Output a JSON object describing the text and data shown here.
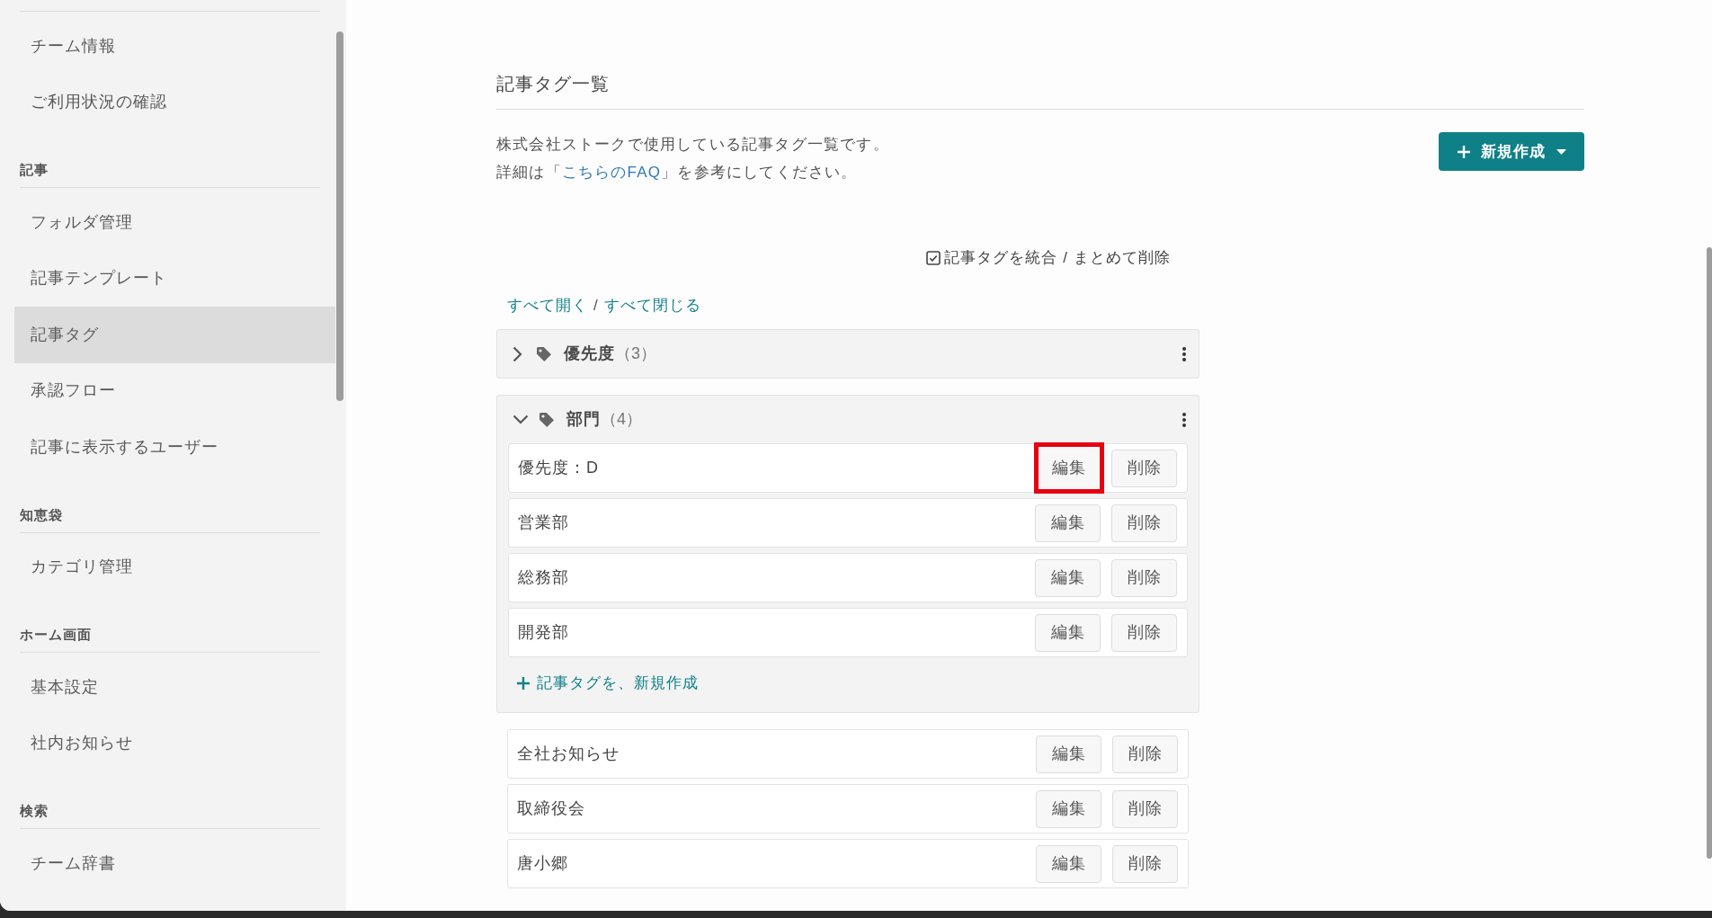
{
  "sidebar": {
    "sections": [
      {
        "items": [
          {
            "label": "チーム情報",
            "selected": false
          },
          {
            "label": "ご利用状況の確認",
            "selected": false
          }
        ]
      },
      {
        "heading": "記事",
        "items": [
          {
            "label": "フォルダ管理",
            "selected": false
          },
          {
            "label": "記事テンプレート",
            "selected": false
          },
          {
            "label": "記事タグ",
            "selected": true
          },
          {
            "label": "承認フロー",
            "selected": false
          },
          {
            "label": "記事に表示するユーザー",
            "selected": false
          }
        ]
      },
      {
        "heading": "知恵袋",
        "items": [
          {
            "label": "カテゴリ管理",
            "selected": false
          }
        ]
      },
      {
        "heading": "ホーム画面",
        "items": [
          {
            "label": "基本設定",
            "selected": false
          },
          {
            "label": "社内お知らせ",
            "selected": false
          }
        ]
      },
      {
        "heading": "検索",
        "items": [
          {
            "label": "チーム辞書",
            "selected": false
          }
        ]
      }
    ]
  },
  "main": {
    "title": "記事タグ一覧",
    "description": [
      {
        "text": "株式会社ストークで使用している記事タグ一覧です。"
      },
      {
        "text": "詳細は「",
        "link": "こちらのFAQ",
        "text_after": "」を参考にしてください。"
      }
    ],
    "new_button": {
      "label": "新規作成"
    },
    "merge_toggle": {
      "label": "記事タグを統合 / まとめて削除"
    },
    "expand_all": "すべて開く",
    "link_separator": "/",
    "collapse_all": "すべて閉じる",
    "groups": [
      {
        "name": "優先度",
        "count": "（3）",
        "expanded": false
      },
      {
        "name": "部門",
        "count": "（4）",
        "expanded": true,
        "tags": [
          {
            "name": "優先度：D",
            "actions": [
              {
                "label": "編集",
                "highlighted": true
              },
              {
                "label": "削除",
                "highlighted": false
              }
            ]
          },
          {
            "name": "営業部",
            "actions": [
              {
                "label": "編集",
                "highlighted": false
              },
              {
                "label": "削除",
                "highlighted": false
              }
            ]
          },
          {
            "name": "総務部",
            "actions": [
              {
                "label": "編集",
                "highlighted": false
              },
              {
                "label": "削除",
                "highlighted": false
              }
            ]
          },
          {
            "name": "開発部",
            "actions": [
              {
                "label": "編集",
                "highlighted": false
              },
              {
                "label": "削除",
                "highlighted": false
              }
            ]
          }
        ],
        "add_link": "記事タグを、新規作成"
      }
    ],
    "ungrouped_tags": [
      {
        "name": "全社お知らせ",
        "actions": [
          {
            "label": "編集",
            "highlighted": false
          },
          {
            "label": "削除",
            "highlighted": false
          }
        ]
      },
      {
        "name": "取締役会",
        "actions": [
          {
            "label": "編集",
            "highlighted": false
          },
          {
            "label": "削除",
            "highlighted": false
          }
        ]
      },
      {
        "name": "唐小郷",
        "actions": [
          {
            "label": "編集",
            "highlighted": false
          },
          {
            "label": "削除",
            "highlighted": false
          }
        ]
      }
    ]
  }
}
